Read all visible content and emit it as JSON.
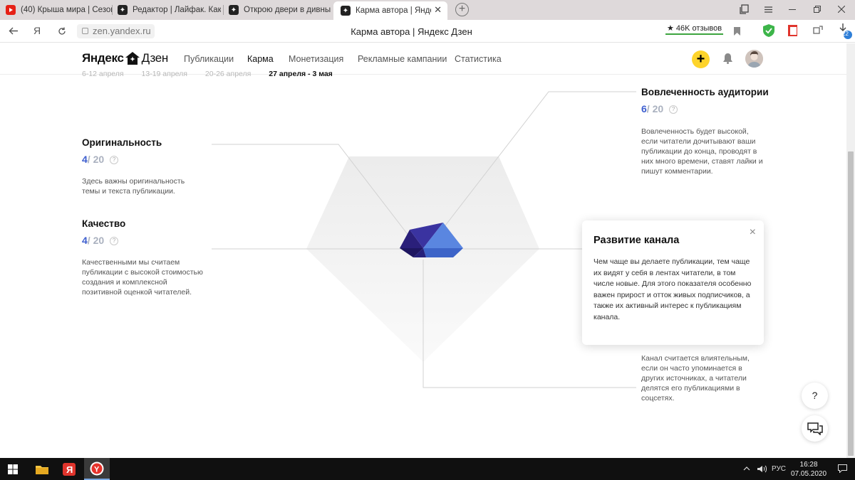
{
  "browser": {
    "tabs": [
      {
        "label": "(40) Крыша мира | Сезон",
        "icon": "youtube-icon",
        "active": false
      },
      {
        "label": "Редактор | Лайфак. Как о",
        "icon": "zen-icon",
        "active": false
      },
      {
        "label": "Открою двери в дивный",
        "icon": "zen-icon",
        "active": false
      },
      {
        "label": "Карма автора | Яндекс",
        "icon": "zen-icon",
        "active": true
      }
    ],
    "url": "zen.yandex.ru",
    "page_title": "Карма автора | Яндекс Дзен",
    "reviews_badge": "46K отзывов",
    "downloads_badge": "22"
  },
  "site": {
    "logo_text": "Яндекс",
    "logo_suffix": "Дзен",
    "nav": [
      {
        "label": "Публикации",
        "active": false
      },
      {
        "label": "Карма",
        "active": true
      },
      {
        "label": "Монетизация",
        "active": false
      },
      {
        "label": "Рекламные кампании",
        "active": false
      },
      {
        "label": "Статистика",
        "active": false
      }
    ],
    "add_button": "+"
  },
  "weeks": [
    "6-12 апреля",
    "13-19 апреля",
    "20-26 апреля",
    "27 апреля - 3 мая"
  ],
  "metrics": {
    "originality": {
      "title": "Оригинальность",
      "score": "4",
      "max": "/ 20",
      "desc": "Здесь важны оригинальность темы и текста публикации."
    },
    "quality": {
      "title": "Качество",
      "score": "4",
      "max": "/ 20",
      "desc": "Качественными мы считаем публикации с высокой стоимостью создания и комплексной позитивной оценкой читателей."
    },
    "engagement": {
      "title": "Вовлеченность аудитории",
      "score": "6",
      "max": "/ 20",
      "desc": "Вовлеченность будет высокой, если читатели дочитывают ваши публикации до конца, проводят в них много времени, ставят лайки и пишут комментарии."
    },
    "influence": {
      "desc": "Канал считается влиятельным, если он часто упоминается в других источниках, а читатели делятся его публикациями в соцсетях."
    }
  },
  "popup": {
    "title": "Развитие канала",
    "text": "Чем чаще вы делаете публикации, тем чаще их видят у себя в лентах читатели, в том числе новые. Для этого показателя особенно важен прирост и отток живых подписчиков, а также их активный интерес к публикациям канала.",
    "close": "×"
  },
  "help_button": "?",
  "colors": {
    "accent": "#fed42b",
    "score_blue": "#3d5ecf",
    "gem_dark": "#2a1f7a",
    "gem_light": "#5f8fe8"
  },
  "taskbar": {
    "language": "РУС",
    "time": "16:28",
    "date": "07.05.2020"
  }
}
